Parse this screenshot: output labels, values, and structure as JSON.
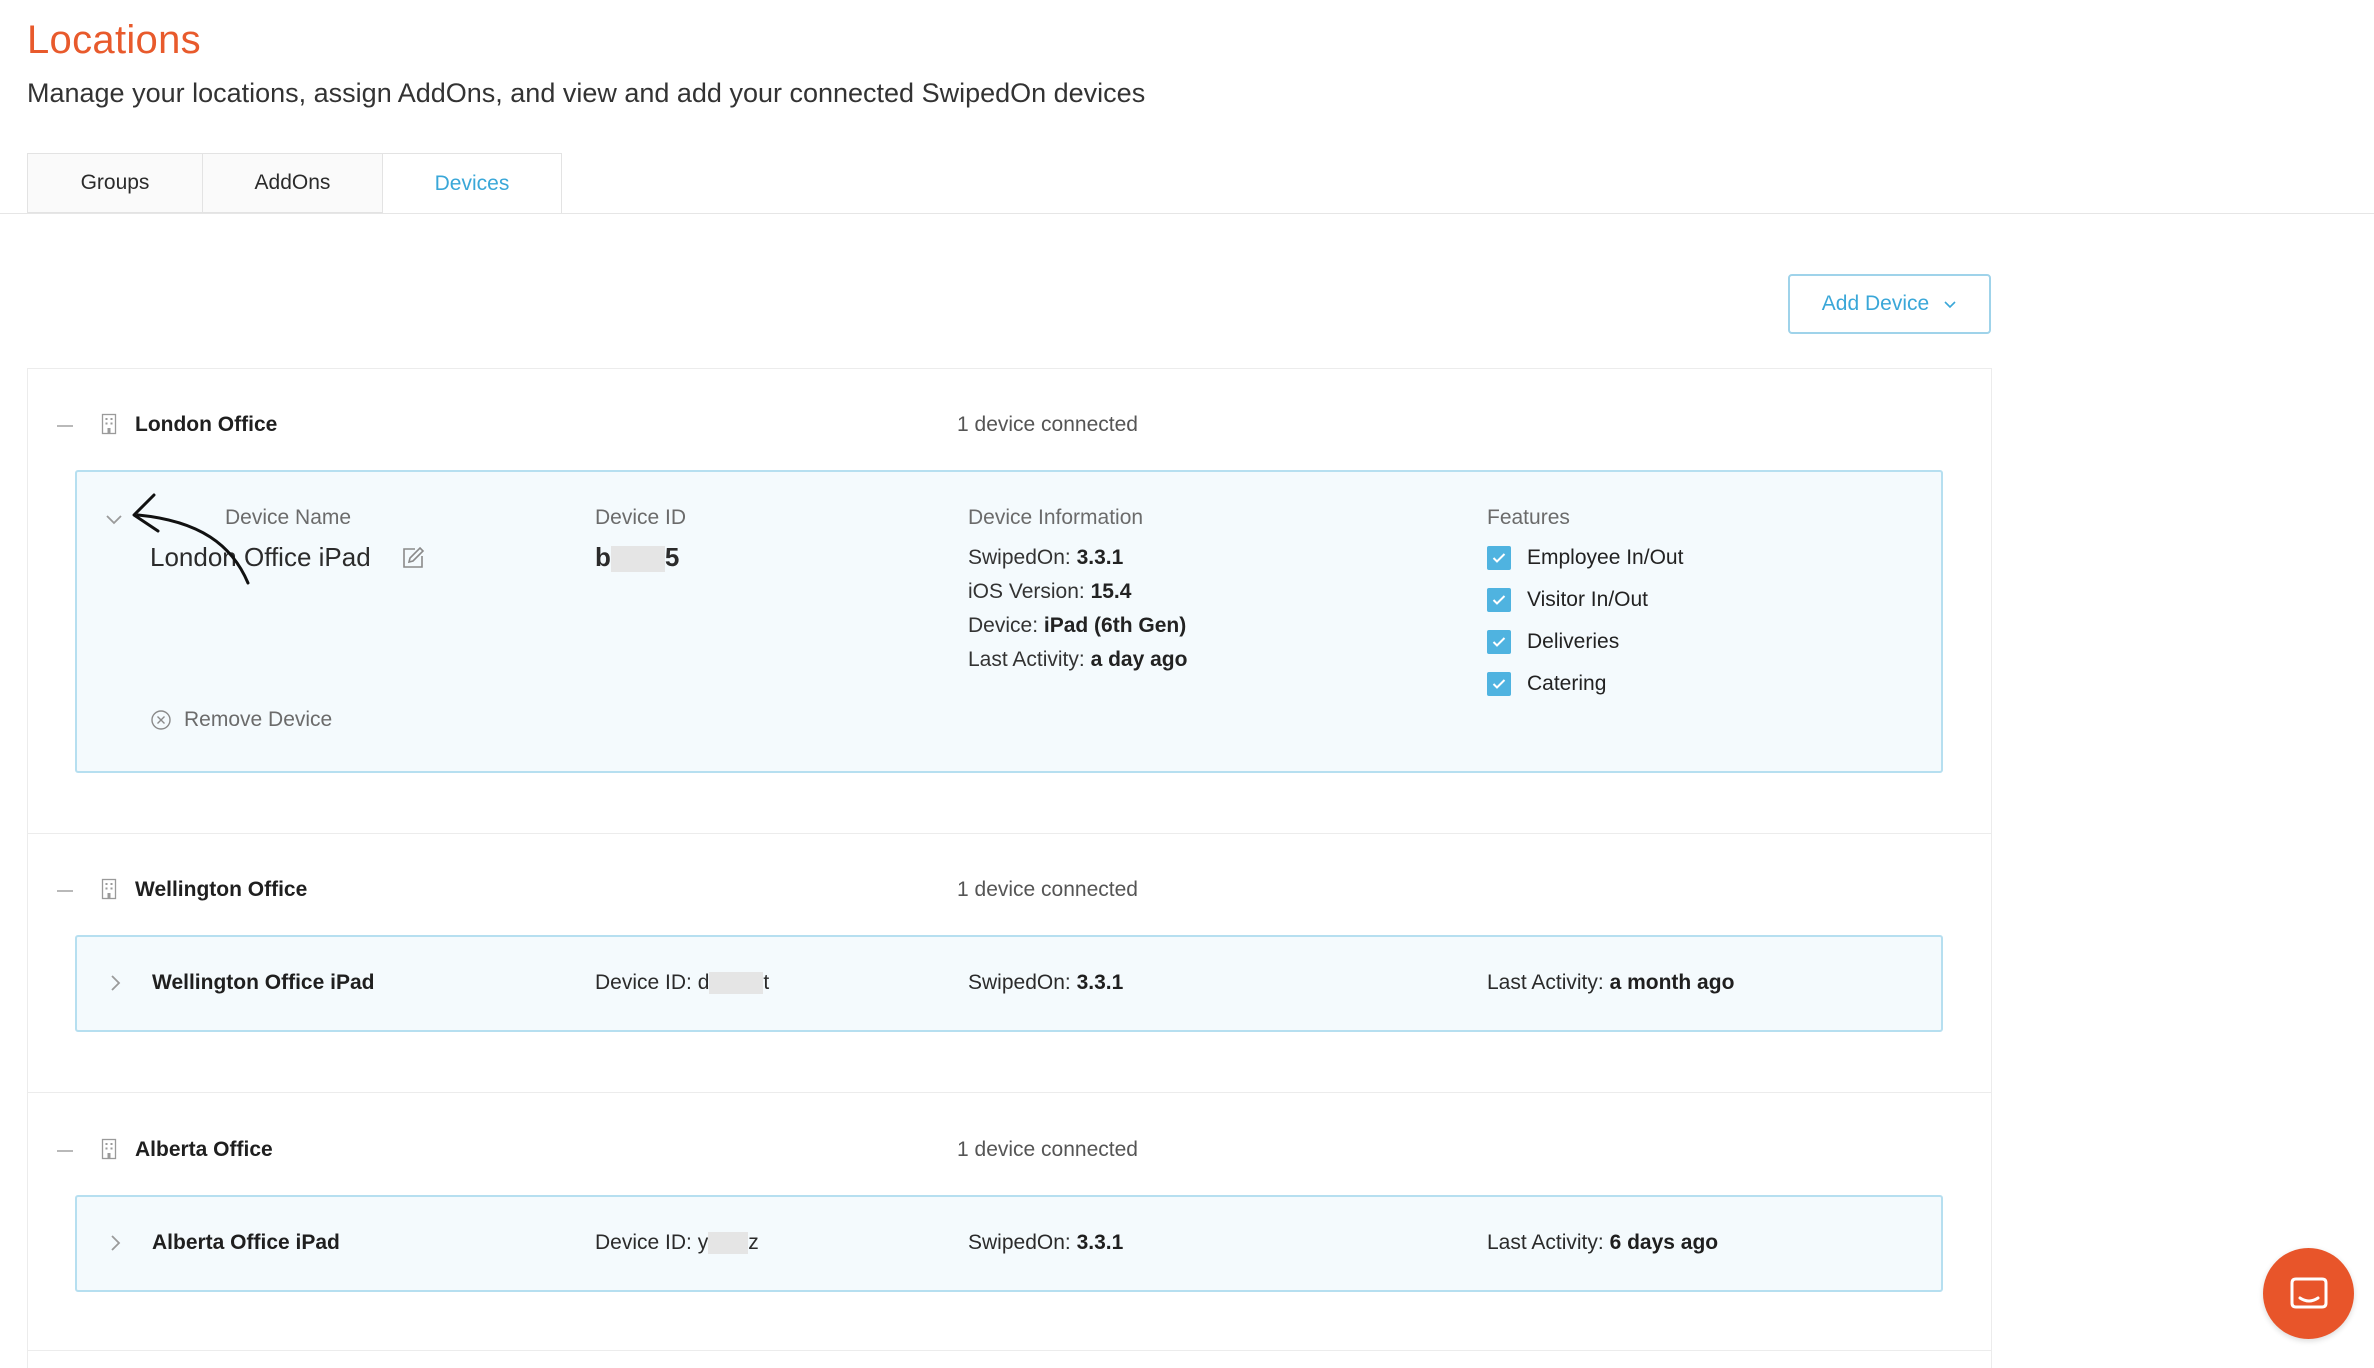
{
  "page": {
    "title": "Locations",
    "subtitle": "Manage your locations, assign AddOns, and view and add your connected SwipedOn devices"
  },
  "tabs": [
    {
      "label": "Groups"
    },
    {
      "label": "AddOns"
    },
    {
      "label": "Devices",
      "active": true
    }
  ],
  "add_device": {
    "label": "Add Device",
    "icon": "chevron-down-icon"
  },
  "colors": {
    "accent": "#3aa7d8",
    "brand": "#e85a2c",
    "card_bg": "#f4fafd",
    "card_border": "#b6dff0",
    "checkbox": "#4fb3e0"
  },
  "groups": [
    {
      "name": "London Office",
      "count": "1 device connected",
      "device": {
        "expanded": true,
        "name_label": "Device Name",
        "name": "London Office iPad",
        "id_label": "Device ID",
        "id_start": "b",
        "id_end": "5",
        "info_label": "Device Information",
        "swipedon_label": "SwipedOn:",
        "swipedon_value": "3.3.1",
        "ios_label": "iOS Version:",
        "ios_value": "15.4",
        "device_label": "Device:",
        "device_value": "iPad (6th Gen)",
        "activity_label": "Last Activity:",
        "activity_value": "a day ago",
        "features_label": "Features",
        "features": [
          {
            "label": "Employee In/Out",
            "checked": true
          },
          {
            "label": "Visitor In/Out",
            "checked": true
          },
          {
            "label": "Deliveries",
            "checked": true
          },
          {
            "label": "Catering",
            "checked": true
          }
        ],
        "remove_label": "Remove Device"
      }
    },
    {
      "name": "Wellington Office",
      "count": "1 device connected",
      "device": {
        "expanded": false,
        "name": "Wellington Office iPad",
        "id_label": "Device ID:",
        "id_start": "d",
        "id_end": "t",
        "swipedon_label": "SwipedOn:",
        "swipedon_value": "3.3.1",
        "activity_label": "Last Activity:",
        "activity_value": "a month ago"
      }
    },
    {
      "name": "Alberta Office",
      "count": "1 device connected",
      "device": {
        "expanded": false,
        "name": "Alberta Office iPad",
        "id_label": "Device ID:",
        "id_start": "y",
        "id_end": "z",
        "swipedon_label": "SwipedOn:",
        "swipedon_value": "3.3.1",
        "activity_label": "Last Activity:",
        "activity_value": "6 days ago"
      }
    }
  ],
  "chat_widget": {
    "icon": "chat-icon"
  }
}
